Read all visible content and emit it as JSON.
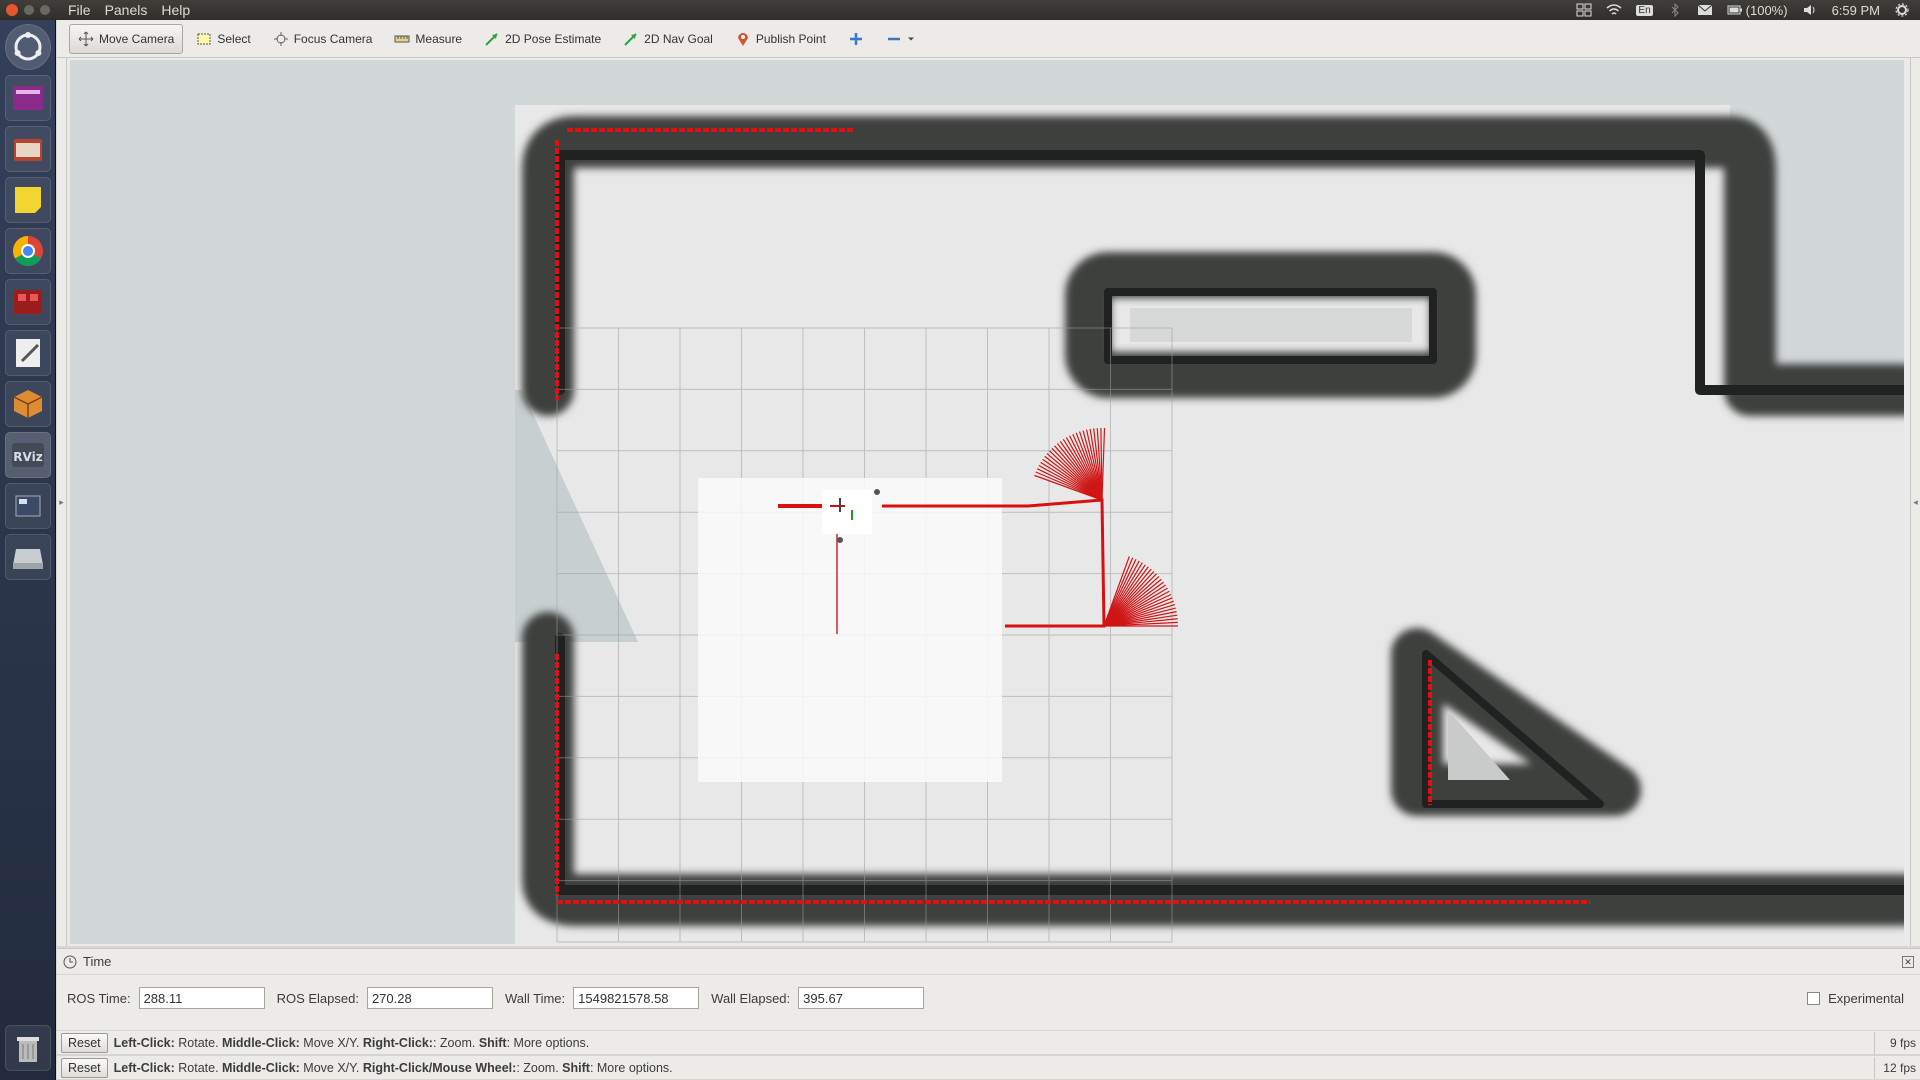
{
  "window": {
    "menu": [
      "File",
      "Panels",
      "Help"
    ]
  },
  "tray": {
    "keyboard": "En",
    "battery": "(100%)",
    "clock": "6:59 PM"
  },
  "launcher": {
    "items": [
      "ubuntu-dash",
      "workspace-switcher",
      "files",
      "sticky-notes",
      "chrome",
      "terminal-app",
      "text-editor",
      "software-center",
      "rviz",
      "window-switcher",
      "drive",
      "trash"
    ]
  },
  "toolbar": {
    "tools": [
      {
        "label": "Move Camera",
        "icon": "move-camera-icon",
        "active": true
      },
      {
        "label": "Select",
        "icon": "select-icon"
      },
      {
        "label": "Focus Camera",
        "icon": "focus-camera-icon"
      },
      {
        "label": "Measure",
        "icon": "measure-icon"
      },
      {
        "label": "2D Pose Estimate",
        "icon": "pose-estimate-icon"
      },
      {
        "label": "2D Nav Goal",
        "icon": "nav-goal-icon"
      },
      {
        "label": "Publish Point",
        "icon": "publish-point-icon"
      }
    ]
  },
  "time_panel": {
    "title": "Time",
    "ros_time_label": "ROS Time:",
    "ros_time": "288.11",
    "ros_elapsed_label": "ROS Elapsed:",
    "ros_elapsed": "270.28",
    "wall_time_label": "Wall Time:",
    "wall_time": "1549821578.58",
    "wall_elapsed_label": "Wall Elapsed:",
    "wall_elapsed": "395.67",
    "experimental_label": "Experimental",
    "experimental_checked": false
  },
  "status": [
    {
      "reset": "Reset",
      "parts": [
        {
          "bold": "Left-Click:",
          "text": " Rotate. "
        },
        {
          "bold": "Middle-Click:",
          "text": " Move X/Y. "
        },
        {
          "bold": "Right-Click:",
          "text": ": Zoom. "
        },
        {
          "bold": "Shift",
          "text": ": More options."
        }
      ],
      "fps": "9 fps"
    },
    {
      "reset": "Reset",
      "parts": [
        {
          "bold": "Left-Click:",
          "text": " Rotate. "
        },
        {
          "bold": "Middle-Click:",
          "text": " Move X/Y. "
        },
        {
          "bold": "Right-Click/Mouse Wheel:",
          "text": ": Zoom. "
        },
        {
          "bold": "Shift",
          "text": ": More options."
        }
      ],
      "fps": "12 fps"
    }
  ],
  "colors": {
    "wall": "#1f2221",
    "inflation": "#3d3f3e",
    "laser": "#e01010",
    "free": "#e8e8e8",
    "unknown": "#d2d7d8",
    "grid": "#9aa0a0"
  }
}
